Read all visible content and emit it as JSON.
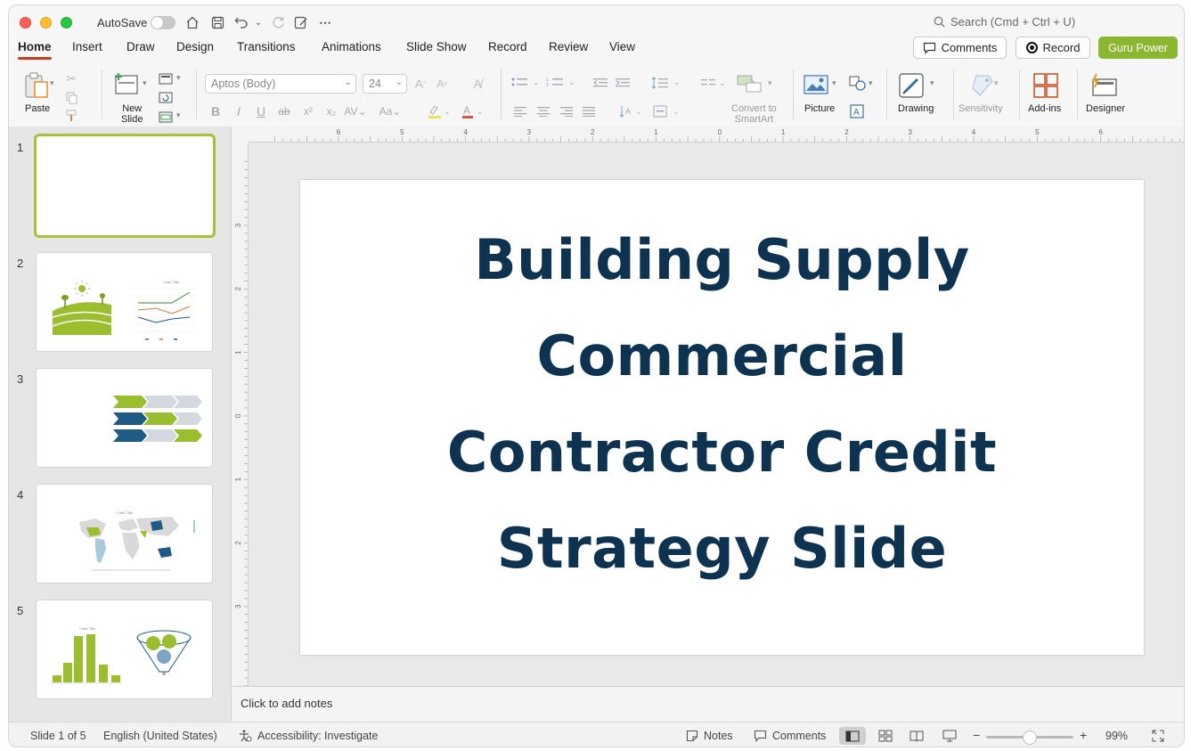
{
  "window": {
    "autosave_label": "AutoSave",
    "search_placeholder": "Search (Cmd + Ctrl + U)"
  },
  "tabs": [
    "Home",
    "Insert",
    "Draw",
    "Design",
    "Transitions",
    "Animations",
    "Slide Show",
    "Record",
    "Review",
    "View"
  ],
  "header_buttons": {
    "comments": "Comments",
    "record": "Record",
    "guru": "Guru Power"
  },
  "ribbon": {
    "paste": "Paste",
    "new_slide_line1": "New",
    "new_slide_line2": "Slide",
    "font_name": "Aptos (Body)",
    "font_size": "24",
    "convert_line1": "Convert to",
    "convert_line2": "SmartArt",
    "picture": "Picture",
    "drawing": "Drawing",
    "sensitivity": "Sensitivity",
    "addins": "Add-ins",
    "designer": "Designer"
  },
  "ruler": {
    "h_labels": [
      "6",
      "5",
      "4",
      "3",
      "2",
      "1",
      "0",
      "1",
      "2",
      "3",
      "4",
      "5",
      "6"
    ],
    "v_labels": [
      "3",
      "2",
      "1",
      "0",
      "1",
      "2",
      "3"
    ]
  },
  "slides": [
    {
      "number": "1"
    },
    {
      "number": "2",
      "chart_title": "Chart Title"
    },
    {
      "number": "3"
    },
    {
      "number": "4",
      "chart_title": "Chart Title"
    },
    {
      "number": "5",
      "chart_title": "Chart Title"
    }
  ],
  "slide": {
    "title": "Building Supply Commercial Contractor Credit Strategy Slide"
  },
  "notes": {
    "placeholder": "Click to add notes"
  },
  "status": {
    "slide_count": "Slide 1 of 5",
    "language": "English (United States)",
    "accessibility": "Accessibility: Investigate",
    "notes": "Notes",
    "comments": "Comments",
    "zoom": "99%"
  },
  "colors": {
    "accent_green": "#8bb730",
    "title_navy": "#0d3350",
    "tab_underline": "#c43e1c",
    "thumb_blue": "#1f5b85"
  }
}
